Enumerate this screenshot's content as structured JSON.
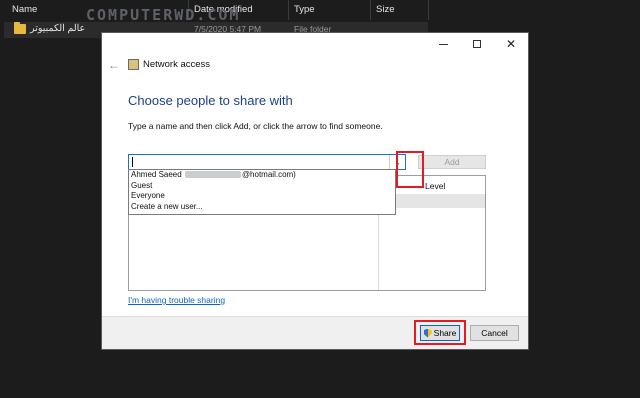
{
  "explorer": {
    "columns": {
      "name": "Name",
      "date": "Date modified",
      "type": "Type",
      "size": "Size"
    },
    "row": {
      "name": "عالم الكمبيوتر",
      "date": "7/5/2020 5:47 PM",
      "type": "File folder"
    },
    "watermark": "COMPUTERWD.COM"
  },
  "dialog": {
    "title": "Network access",
    "heading": "Choose people to share with",
    "instruction": "Type a name and then click Add, or click the arrow to find someone.",
    "add_label": "Add",
    "permission_header": "Level",
    "dropdown_options": {
      "o1_start": "Ahmed Saeed",
      "o1_end": "@hotmail.com)",
      "o2": "Guest",
      "o3": "Everyone",
      "o4": "Create a new user..."
    },
    "trouble_link": "I'm having trouble sharing",
    "share_label": "Share",
    "cancel_label": "Cancel"
  },
  "icons": [
    "back-arrow-icon",
    "network-icon",
    "dropdown-arrow-icon",
    "shield-icon",
    "folder-icon"
  ],
  "colors": {
    "heading": "#1e3f8b",
    "link": "#0a66c2",
    "highlight": "#e31b23",
    "folder": "#e8b93f"
  }
}
